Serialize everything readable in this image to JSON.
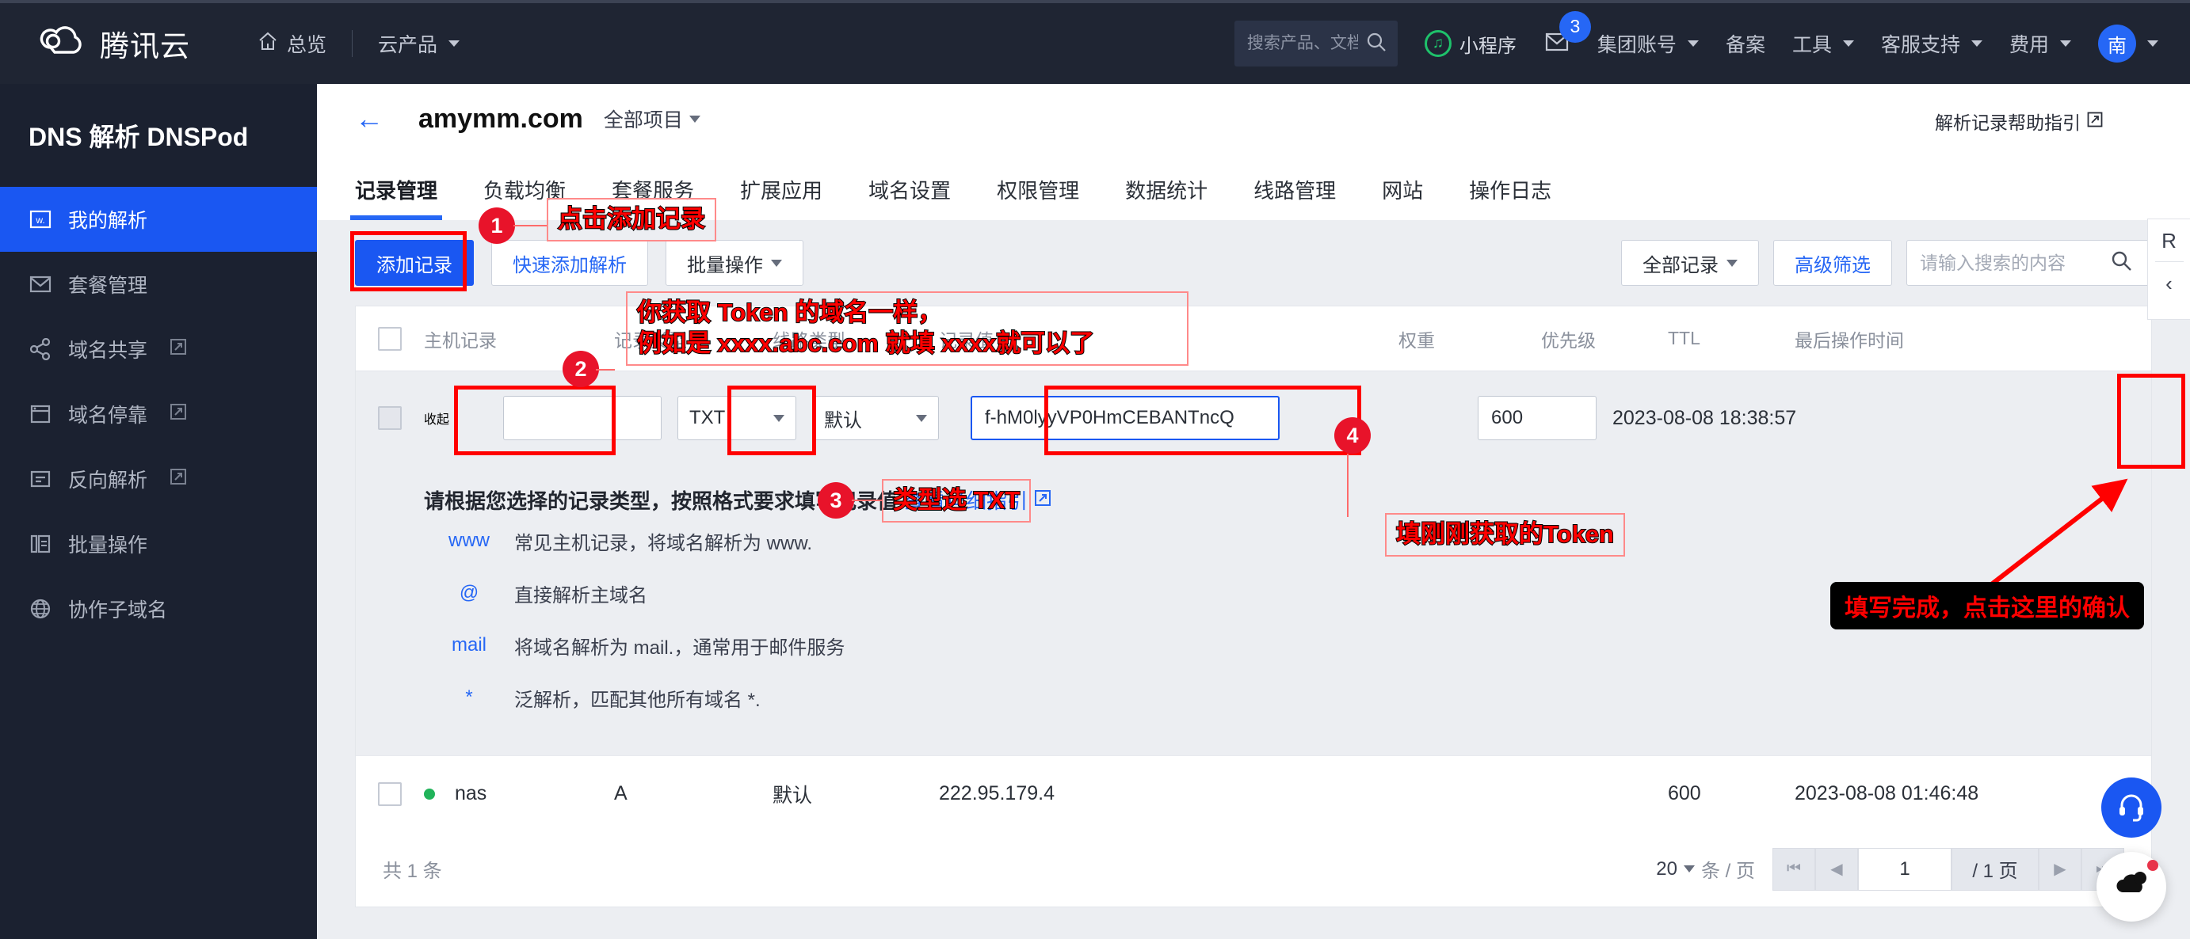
{
  "topnav": {
    "brand": "腾讯云",
    "overview": "总览",
    "products": "云产品",
    "search_placeholder": "搜索产品、文档...",
    "mini_program": "小程序",
    "mail_badge": "3",
    "group_account": "集团账号",
    "beian": "备案",
    "tools": "工具",
    "support": "客服支持",
    "fee": "费用",
    "avatar_initial": "南"
  },
  "sidebar": {
    "title": "DNS 解析 DNSPod",
    "items": [
      {
        "label": "我的解析",
        "icon": "resolve-icon",
        "external": false,
        "active": true
      },
      {
        "label": "套餐管理",
        "icon": "package-icon",
        "external": false,
        "active": false
      },
      {
        "label": "域名共享",
        "icon": "share-icon",
        "external": true,
        "active": false
      },
      {
        "label": "域名停靠",
        "icon": "park-icon",
        "external": true,
        "active": false
      },
      {
        "label": "反向解析",
        "icon": "reverse-icon",
        "external": true,
        "active": false
      },
      {
        "label": "批量操作",
        "icon": "batch-icon",
        "external": false,
        "active": false
      },
      {
        "label": "协作子域名",
        "icon": "globe-icon",
        "external": false,
        "active": false
      }
    ]
  },
  "page": {
    "domain": "amymm.com",
    "project_selector": "全部项目",
    "help_link": "解析记录帮助指引",
    "tabs": [
      {
        "label": "记录管理",
        "active": true
      },
      {
        "label": "负载均衡",
        "active": false
      },
      {
        "label": "套餐服务",
        "active": false
      },
      {
        "label": "扩展应用",
        "active": false
      },
      {
        "label": "域名设置",
        "active": false
      },
      {
        "label": "权限管理",
        "active": false
      },
      {
        "label": "数据统计",
        "active": false
      },
      {
        "label": "线路管理",
        "active": false
      },
      {
        "label": "网站",
        "active": false
      },
      {
        "label": "操作日志",
        "active": false
      }
    ]
  },
  "toolbar": {
    "add_record": "添加记录",
    "quick_add": "快速添加解析",
    "batch_ops": "批量操作",
    "filter_all": "全部记录",
    "advanced_filter": "高级筛选",
    "search_placeholder": "请输入搜索的内容"
  },
  "table": {
    "headers": {
      "host": "主机记录",
      "type": "记录类型",
      "line": "线路类型",
      "value": "记录值",
      "weight": "权重",
      "priority": "优先级",
      "ttl": "TTL",
      "time": "最后操作时间"
    },
    "edit_row": {
      "collapse": "收起",
      "host_value": "",
      "host_placeholder": "",
      "type_value": "TXT",
      "line_value": "默认",
      "record_value": "f-hM0lyyVP0HmCEBANTncQ",
      "ttl_value": "600",
      "time": "2023-08-08 18:38:57"
    },
    "help": {
      "title": "请根据您选择的记录类型，按照格式要求填写记录值",
      "link": "查看详细指引",
      "rows": [
        {
          "key": "www",
          "desc": "常见主机记录，将域名解析为 www."
        },
        {
          "key": "@",
          "desc": "直接解析主域名"
        },
        {
          "key": "mail",
          "desc": "将域名解析为 mail.，通常用于邮件服务"
        },
        {
          "key": "*",
          "desc": "泛解析，匹配其他所有域名 *."
        }
      ]
    },
    "rows": [
      {
        "host": "nas",
        "type": "A",
        "line": "默认",
        "value": "222.95.179.4",
        "weight": "",
        "priority": "",
        "ttl": "600",
        "time": "2023-08-08 01:46:48",
        "status": "active"
      }
    ]
  },
  "pagination": {
    "total": "共 1 条",
    "page_size": "20",
    "per_page_label": "条 / 页",
    "current_page": "1",
    "total_pages": "/ 1 页"
  },
  "rail": {
    "r_label": "R",
    "collapse_icon": "chevron-left-icon"
  },
  "annotations": [
    {
      "id": "1",
      "text": "点击添加记录"
    },
    {
      "id": "2",
      "text": "你获取 Token 的域名一样，\n例如是 xxxx.abc.com 就填 xxxx就可以了"
    },
    {
      "id": "3",
      "text": "类型选 TXT"
    },
    {
      "id": "4",
      "text": "填刚刚获取的Token"
    },
    {
      "id": "5",
      "text": "填写完成，点击这里的确认"
    }
  ],
  "colors": {
    "accent": "#1a57f2",
    "annotation": "#ff0000",
    "nav_bg": "#1f2533",
    "sidebar_bg": "#1b2130",
    "page_bg": "#eceef2"
  }
}
